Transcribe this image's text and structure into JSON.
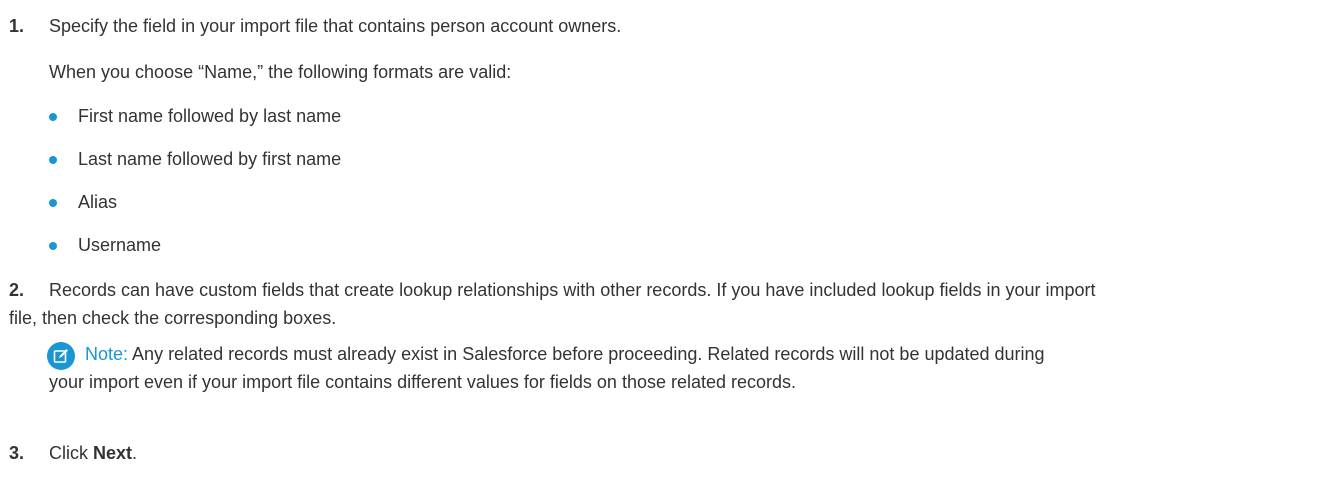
{
  "steps": [
    {
      "number": "1.",
      "text": "Specify the field in your import file that contains person account owners.",
      "detail": "When you choose “Name,” the following formats are valid:",
      "bullets": [
        "First name followed by last name",
        "Last name followed by first name",
        "Alias",
        "Username"
      ]
    },
    {
      "number": "2.",
      "text_line1": "Records can have custom fields that create lookup relationships with other records. If you have included lookup fields in your import",
      "text_line2": "file, then check the corresponding boxes.",
      "note": {
        "icon": "edit-note-icon",
        "label": "Note:",
        "line1": "Any related records must already exist in Salesforce before proceeding. Related records will not be updated during",
        "line2": "your import even if your import file contains different values for fields on those related records."
      }
    },
    {
      "number": "3.",
      "prefix": "Click ",
      "bold": "Next",
      "suffix": "."
    }
  ],
  "colors": {
    "accent": "#1b96d5",
    "text": "#333333"
  }
}
